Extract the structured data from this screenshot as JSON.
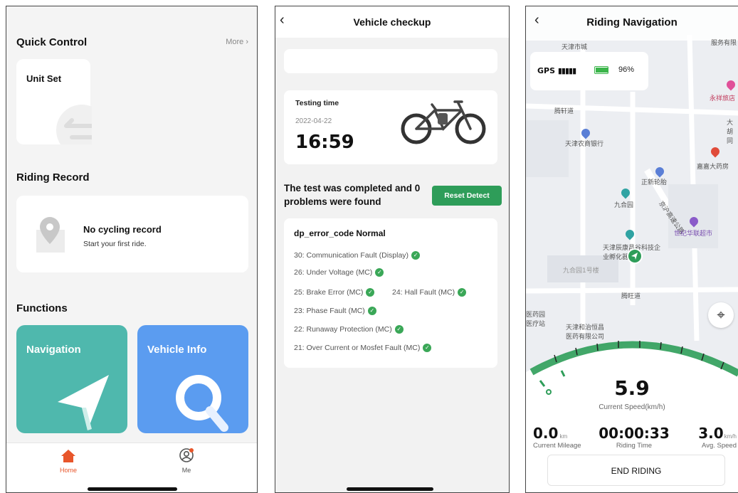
{
  "screen1": {
    "quick_control": {
      "title": "Quick Control",
      "more": "More",
      "unit_set": "Unit Set"
    },
    "riding_record": {
      "title": "Riding Record",
      "empty_title": "No cycling record",
      "empty_sub": "Start your first ride."
    },
    "functions": {
      "title": "Functions",
      "navigation": "Navigation",
      "vehicle_info": "Vehicle Info"
    },
    "tabbar": {
      "home": "Home",
      "me": "Me"
    },
    "colors": {
      "accent": "#e8562b",
      "navigation_card": "#4fb8ad",
      "vehicle_card": "#5b9cf0"
    }
  },
  "screen2": {
    "title": "Vehicle checkup",
    "testing_time_label": "Testing time",
    "date": "2022-04-22",
    "time": "16:59",
    "result_text": "The test was completed and 0 problems were found",
    "reset_button": "Reset Detect",
    "error_header": "dp_error_code Normal",
    "faults": [
      "30: Communication Fault (Display)",
      "26: Under Voltage (MC)",
      "25: Brake Error (MC)",
      "24: Hall Fault (MC)",
      "23: Phase Fault (MC)",
      "22: Runaway Protection (MC)",
      "21: Over Current or Mosfet Fault (MC)"
    ],
    "colors": {
      "ok_green": "#3aa757"
    }
  },
  "screen3": {
    "title": "Riding Navigation",
    "gps_label": "GPS",
    "battery": "96%",
    "map_labels": [
      "服务有限",
      "天津市城",
      "腾轩道",
      "永祥旅店",
      "天津农商银行",
      "大胡同",
      "嘉嘉大药房",
      "正新轮胎",
      "九合园",
      "京沪高速公路",
      "世纪华联超市",
      "天津辰康昌谷科技企业孵化器",
      "九合园1号楼",
      "腾旺道",
      "医药园医疗站",
      "天津和治恒昌医药有限公司"
    ],
    "speed": "5.9",
    "speed_label": "Current Speed(km/h)",
    "mileage_value": "0.0",
    "mileage_unit": "km",
    "mileage_label": "Current Mileage",
    "riding_time": "00:00:33",
    "riding_time_label": "Riding Time",
    "avg_speed_value": "3.0",
    "avg_speed_unit": "km/h",
    "avg_speed_label": "Avg. Speed",
    "end_button": "END RIDING",
    "colors": {
      "route_green": "#2e9d59",
      "battery_green": "#3bb54a"
    }
  }
}
